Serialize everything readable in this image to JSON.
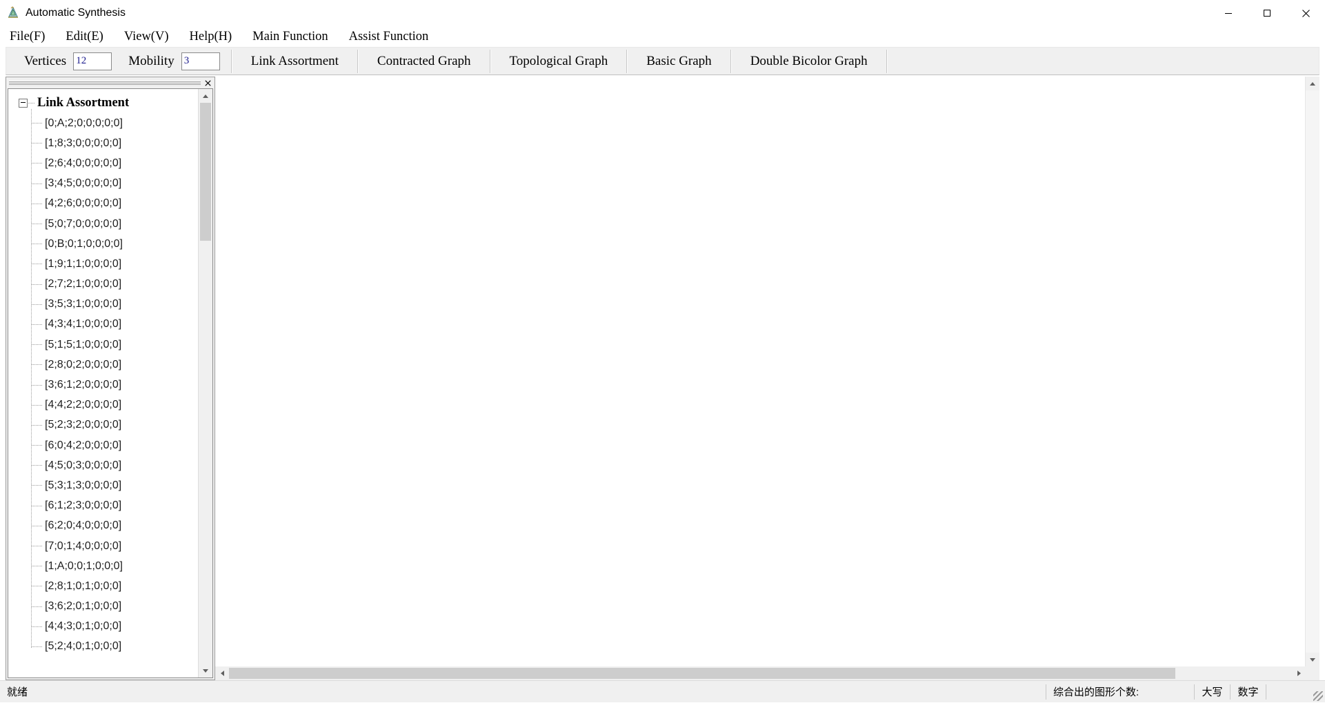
{
  "window": {
    "title": "Automatic Synthesis",
    "icon": "app-icon",
    "minimize_label": "─",
    "maximize_label": "□",
    "close_label": "✕"
  },
  "menubar": {
    "items": [
      {
        "label": "File(F)"
      },
      {
        "label": "Edit(E)"
      },
      {
        "label": "View(V)"
      },
      {
        "label": "Help(H)"
      },
      {
        "label": "Main Function"
      },
      {
        "label": "Assist Function"
      }
    ]
  },
  "toolbar": {
    "vertices_label": "Vertices",
    "vertices_value": "12",
    "mobility_label": "Mobility",
    "mobility_value": "3",
    "buttons": [
      {
        "label": "Link Assortment"
      },
      {
        "label": "Contracted Graph"
      },
      {
        "label": "Topological Graph"
      },
      {
        "label": "Basic Graph"
      },
      {
        "label": "Double Bicolor Graph"
      }
    ]
  },
  "tree_pane": {
    "close_label": "✕",
    "root_label": "Link Assortment",
    "nodes": [
      {
        "label": "[0;A;2;0;0;0;0;0]"
      },
      {
        "label": "[1;8;3;0;0;0;0;0]"
      },
      {
        "label": "[2;6;4;0;0;0;0;0]"
      },
      {
        "label": "[3;4;5;0;0;0;0;0]"
      },
      {
        "label": "[4;2;6;0;0;0;0;0]"
      },
      {
        "label": "[5;0;7;0;0;0;0;0]"
      },
      {
        "label": "[0;B;0;1;0;0;0;0]"
      },
      {
        "label": "[1;9;1;1;0;0;0;0]"
      },
      {
        "label": "[2;7;2;1;0;0;0;0]"
      },
      {
        "label": "[3;5;3;1;0;0;0;0]"
      },
      {
        "label": "[4;3;4;1;0;0;0;0]"
      },
      {
        "label": "[5;1;5;1;0;0;0;0]"
      },
      {
        "label": "[2;8;0;2;0;0;0;0]"
      },
      {
        "label": "[3;6;1;2;0;0;0;0]"
      },
      {
        "label": "[4;4;2;2;0;0;0;0]"
      },
      {
        "label": "[5;2;3;2;0;0;0;0]"
      },
      {
        "label": "[6;0;4;2;0;0;0;0]"
      },
      {
        "label": "[4;5;0;3;0;0;0;0]"
      },
      {
        "label": "[5;3;1;3;0;0;0;0]"
      },
      {
        "label": "[6;1;2;3;0;0;0;0]"
      },
      {
        "label": "[6;2;0;4;0;0;0;0]"
      },
      {
        "label": "[7;0;1;4;0;0;0;0]"
      },
      {
        "label": "[1;A;0;0;1;0;0;0]"
      },
      {
        "label": "[2;8;1;0;1;0;0;0]"
      },
      {
        "label": "[3;6;2;0;1;0;0;0]"
      },
      {
        "label": "[4;4;3;0;1;0;0;0]"
      },
      {
        "label": "[5;2;4;0;1;0;0;0]"
      }
    ]
  },
  "statusbar": {
    "ready_text": "就绪",
    "count_label": "综合出的图形个数:",
    "caps_label": "大写",
    "num_label": "数字",
    "blank_label": ""
  },
  "colors": {
    "toolbar_bg": "#f0f0f0",
    "window_bg": "#ffffff",
    "input_text": "#1a1a8c",
    "scrollbar_thumb": "#cdcdcd"
  }
}
